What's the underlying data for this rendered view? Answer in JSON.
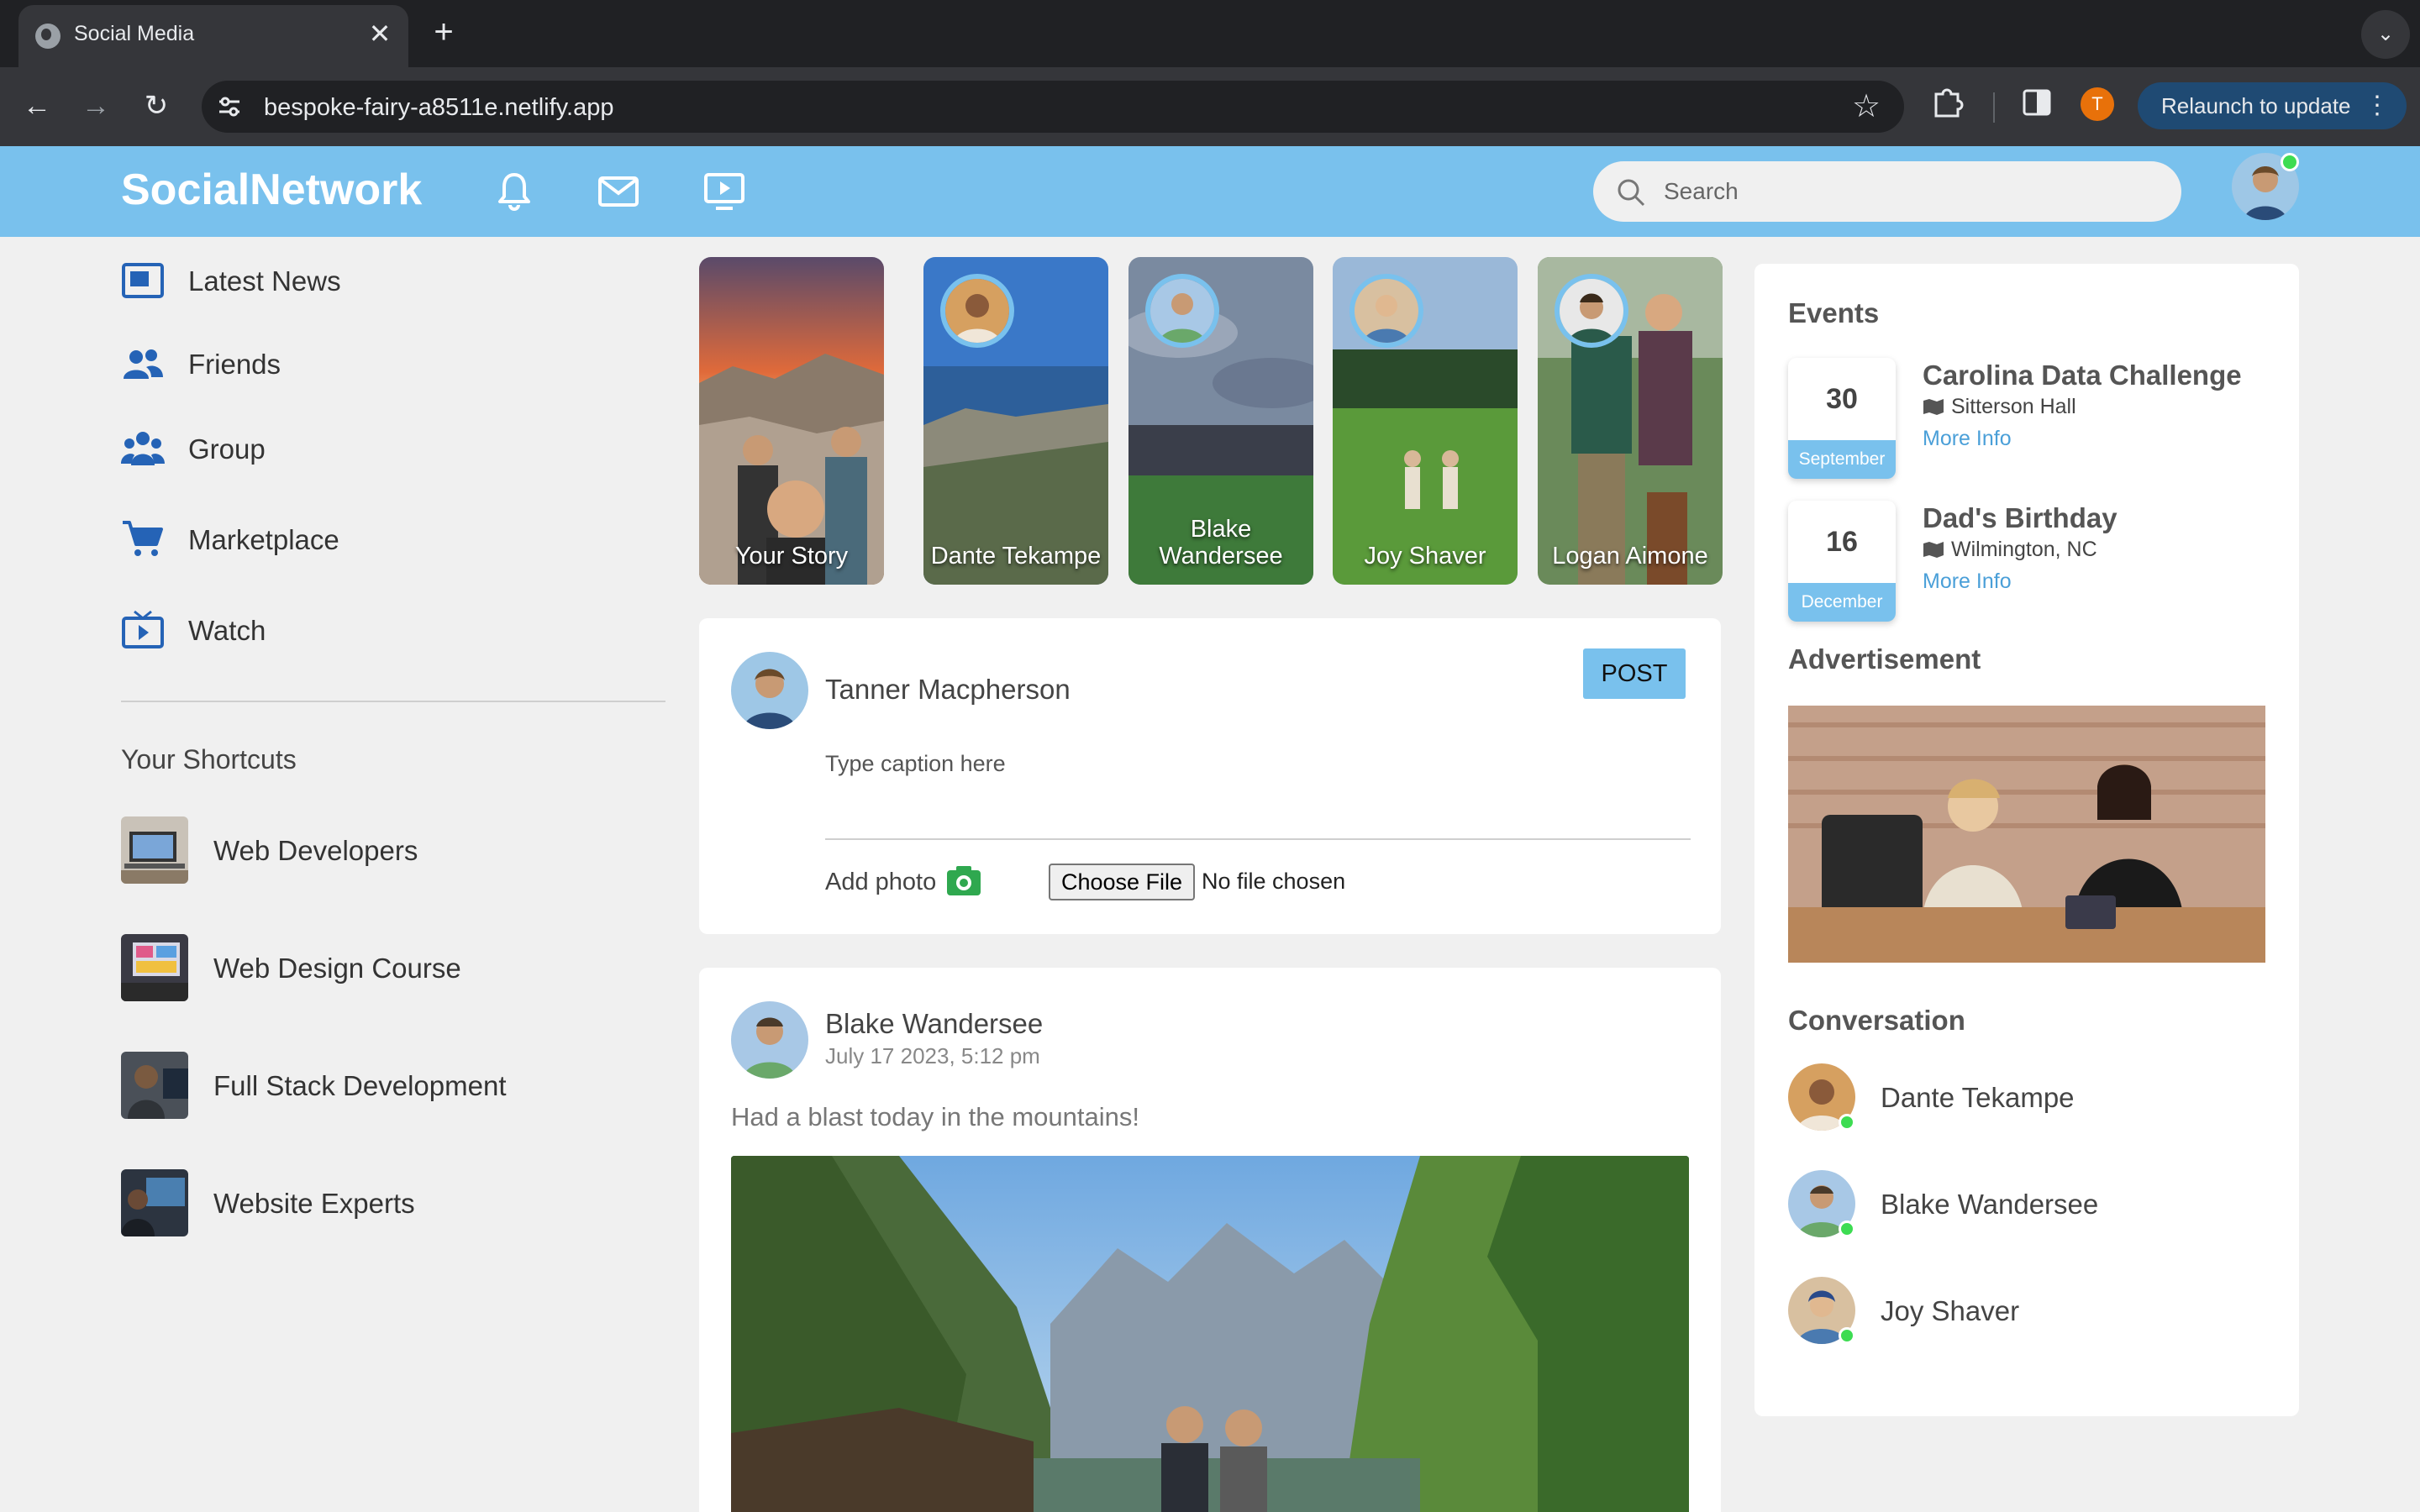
{
  "browser": {
    "tab_title": "Social Media",
    "tab_close": "✕",
    "new_tab": "+",
    "tab_menu": "⌄",
    "url": "bespoke-fairy-a8511e.netlify.app",
    "profile_initial": "T",
    "relaunch_label": "Relaunch to update",
    "back": "←",
    "forward": "→",
    "reload": "↻",
    "star": "☆"
  },
  "header": {
    "logo": "SocialNetwork",
    "search_placeholder": "Search",
    "accent_color": "#79c1ed"
  },
  "sidebar": {
    "items": [
      {
        "label": "Latest News",
        "icon": "news-icon"
      },
      {
        "label": "Friends",
        "icon": "friends-icon"
      },
      {
        "label": "Group",
        "icon": "group-icon"
      },
      {
        "label": "Marketplace",
        "icon": "cart-icon"
      },
      {
        "label": "Watch",
        "icon": "tv-icon"
      }
    ],
    "shortcuts_title": "Your Shortcuts",
    "shortcuts": [
      {
        "label": "Web Developers"
      },
      {
        "label": "Web Design Course"
      },
      {
        "label": "Full Stack Development"
      },
      {
        "label": "Website Experts"
      }
    ]
  },
  "stories": [
    {
      "name": "Your Story"
    },
    {
      "name": "Dante Tekampe"
    },
    {
      "name": "Blake Wandersee"
    },
    {
      "name": "Joy Shaver"
    },
    {
      "name": "Logan Aimone"
    }
  ],
  "composer": {
    "user_name": "Tanner Macpherson",
    "post_label": "POST",
    "caption_placeholder": "Type caption here",
    "add_photo_label": "Add photo",
    "choose_file_label": "Choose File",
    "no_file_label": "No file chosen"
  },
  "post": {
    "author": "Blake Wandersee",
    "timestamp": "July 17 2023, 5:12 pm",
    "text": "Had a blast today in the mountains!"
  },
  "right": {
    "events_title": "Events",
    "events": [
      {
        "day": "30",
        "month": "September",
        "title": "Carolina Data Challenge",
        "location": "Sitterson Hall",
        "more": "More Info"
      },
      {
        "day": "16",
        "month": "December",
        "title": "Dad's Birthday",
        "location": "Wilmington, NC",
        "more": "More Info"
      }
    ],
    "ad_title": "Advertisement",
    "conversation_title": "Conversation",
    "conversations": [
      {
        "name": "Dante Tekampe"
      },
      {
        "name": "Blake Wandersee"
      },
      {
        "name": "Joy Shaver"
      }
    ]
  }
}
